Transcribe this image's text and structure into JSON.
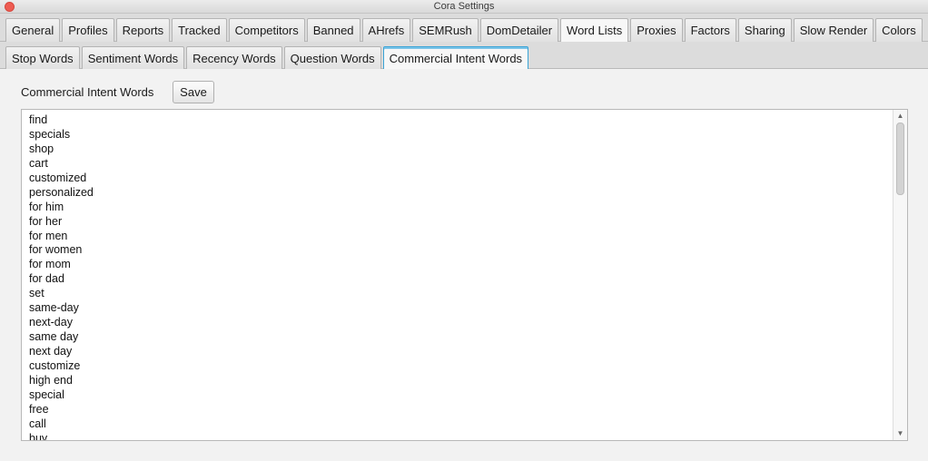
{
  "window": {
    "title": "Cora Settings"
  },
  "main_tabs": [
    {
      "label": "General"
    },
    {
      "label": "Profiles"
    },
    {
      "label": "Reports"
    },
    {
      "label": "Tracked"
    },
    {
      "label": "Competitors"
    },
    {
      "label": "Banned"
    },
    {
      "label": "AHrefs"
    },
    {
      "label": "SEMRush"
    },
    {
      "label": "DomDetailer"
    },
    {
      "label": "Word Lists"
    },
    {
      "label": "Proxies"
    },
    {
      "label": "Factors"
    },
    {
      "label": "Sharing"
    },
    {
      "label": "Slow Render"
    },
    {
      "label": "Colors"
    }
  ],
  "main_tab_selected": "Word Lists",
  "sub_tabs": [
    {
      "label": "Stop Words"
    },
    {
      "label": "Sentiment Words"
    },
    {
      "label": "Recency Words"
    },
    {
      "label": "Question Words"
    },
    {
      "label": "Commercial Intent Words"
    }
  ],
  "sub_tab_selected": "Commercial Intent Words",
  "panel": {
    "label": "Commercial Intent Words",
    "save_label": "Save",
    "words": [
      "find",
      "specials",
      "shop",
      "cart",
      "customized",
      "personalized",
      "for him",
      "for her",
      "for men",
      "for women",
      "for mom",
      "for dad",
      "set",
      "same-day",
      "next-day",
      "same day",
      "next day",
      "customize",
      "high end",
      "special",
      "free",
      "call",
      "buy"
    ]
  },
  "colors": {
    "close_button": "#ee5c52",
    "selected_subtab_border": "#39a3d6"
  },
  "icons": {
    "scroll_up": "▲",
    "scroll_down": "▼"
  }
}
